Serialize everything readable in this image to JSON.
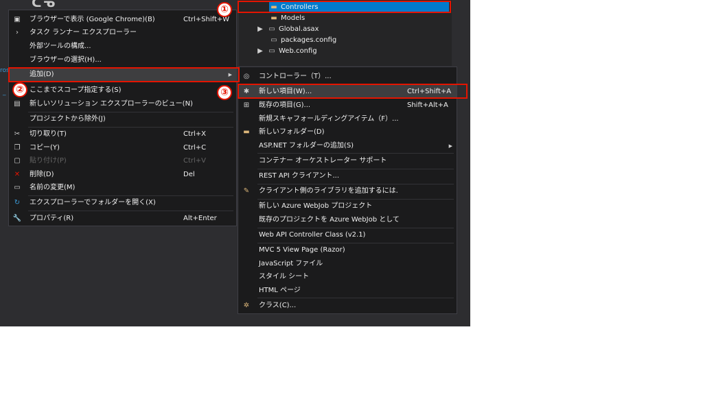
{
  "tree": {
    "items": [
      {
        "label": "Controllers",
        "icon": "folder-icon"
      },
      {
        "label": "Models",
        "icon": "folder-icon"
      },
      {
        "label": "Global.asax",
        "icon": "file-icon"
      },
      {
        "label": "packages.config",
        "icon": "file-icon"
      },
      {
        "label": "Web.config",
        "icon": "file-icon"
      }
    ]
  },
  "left_link": "ros",
  "context_menu": {
    "items": [
      {
        "label": "ブラウザーで表示 (Google Chrome)(B)",
        "shortcut": "Ctrl+Shift+W"
      },
      {
        "label": "タスク ランナー エクスプローラー",
        "shortcut": ""
      },
      {
        "label": "外部ツールの構成...",
        "shortcut": ""
      },
      {
        "label": "ブラウザーの選択(H)...",
        "shortcut": ""
      },
      {
        "label": "追加(D)",
        "shortcut": ""
      },
      {
        "label": "ここまでスコープ指定する(S)",
        "shortcut": ""
      },
      {
        "label": "新しいソリューション エクスプローラーのビュー(N)",
        "shortcut": ""
      },
      {
        "label": "プロジェクトから除外(J)",
        "shortcut": ""
      },
      {
        "label": "切り取り(T)",
        "shortcut": "Ctrl+X"
      },
      {
        "label": "コピー(Y)",
        "shortcut": "Ctrl+C"
      },
      {
        "label": "貼り付け(P)",
        "shortcut": "Ctrl+V"
      },
      {
        "label": "削除(D)",
        "shortcut": "Del"
      },
      {
        "label": "名前の変更(M)",
        "shortcut": ""
      },
      {
        "label": "エクスプローラーでフォルダーを開く(X)",
        "shortcut": ""
      },
      {
        "label": "プロパティ(R)",
        "shortcut": "Alt+Enter"
      }
    ]
  },
  "add_submenu": {
    "items": [
      {
        "label": "コントローラー（T）...",
        "shortcut": ""
      },
      {
        "label": "新しい項目(W)...",
        "shortcut": "Ctrl+Shift+A"
      },
      {
        "label": "既存の項目(G)...",
        "shortcut": "Shift+Alt+A"
      },
      {
        "label": "新規スキャフォールディングアイテム（F）...",
        "shortcut": ""
      },
      {
        "label": "新しいフォルダー(D)",
        "shortcut": ""
      },
      {
        "label": "ASP.NET フォルダーの追加(S)",
        "shortcut": ""
      },
      {
        "label": "コンテナー オーケストレーター サポート",
        "shortcut": ""
      },
      {
        "label": "REST API クライアント...",
        "shortcut": ""
      },
      {
        "label": "クライアント側のライブラリを追加するには.",
        "shortcut": ""
      },
      {
        "label": "新しい Azure WebJob プロジェクト",
        "shortcut": ""
      },
      {
        "label": "既存のプロジェクトを Azure WebJob として",
        "shortcut": ""
      },
      {
        "label": "Web API Controller Class (v2.1)",
        "shortcut": ""
      },
      {
        "label": "MVC 5 View Page (Razor)",
        "shortcut": ""
      },
      {
        "label": "JavaScript ファイル",
        "shortcut": ""
      },
      {
        "label": "スタイル シート",
        "shortcut": ""
      },
      {
        "label": "HTML ページ",
        "shortcut": ""
      },
      {
        "label": "クラス(C)...",
        "shortcut": ""
      }
    ]
  },
  "annotations": {
    "one": "①",
    "two": "②",
    "three": "③"
  },
  "colors": {
    "accent": "#007acc",
    "highlight_box": "#e51400",
    "menu_bg": "#1b1b1c"
  }
}
